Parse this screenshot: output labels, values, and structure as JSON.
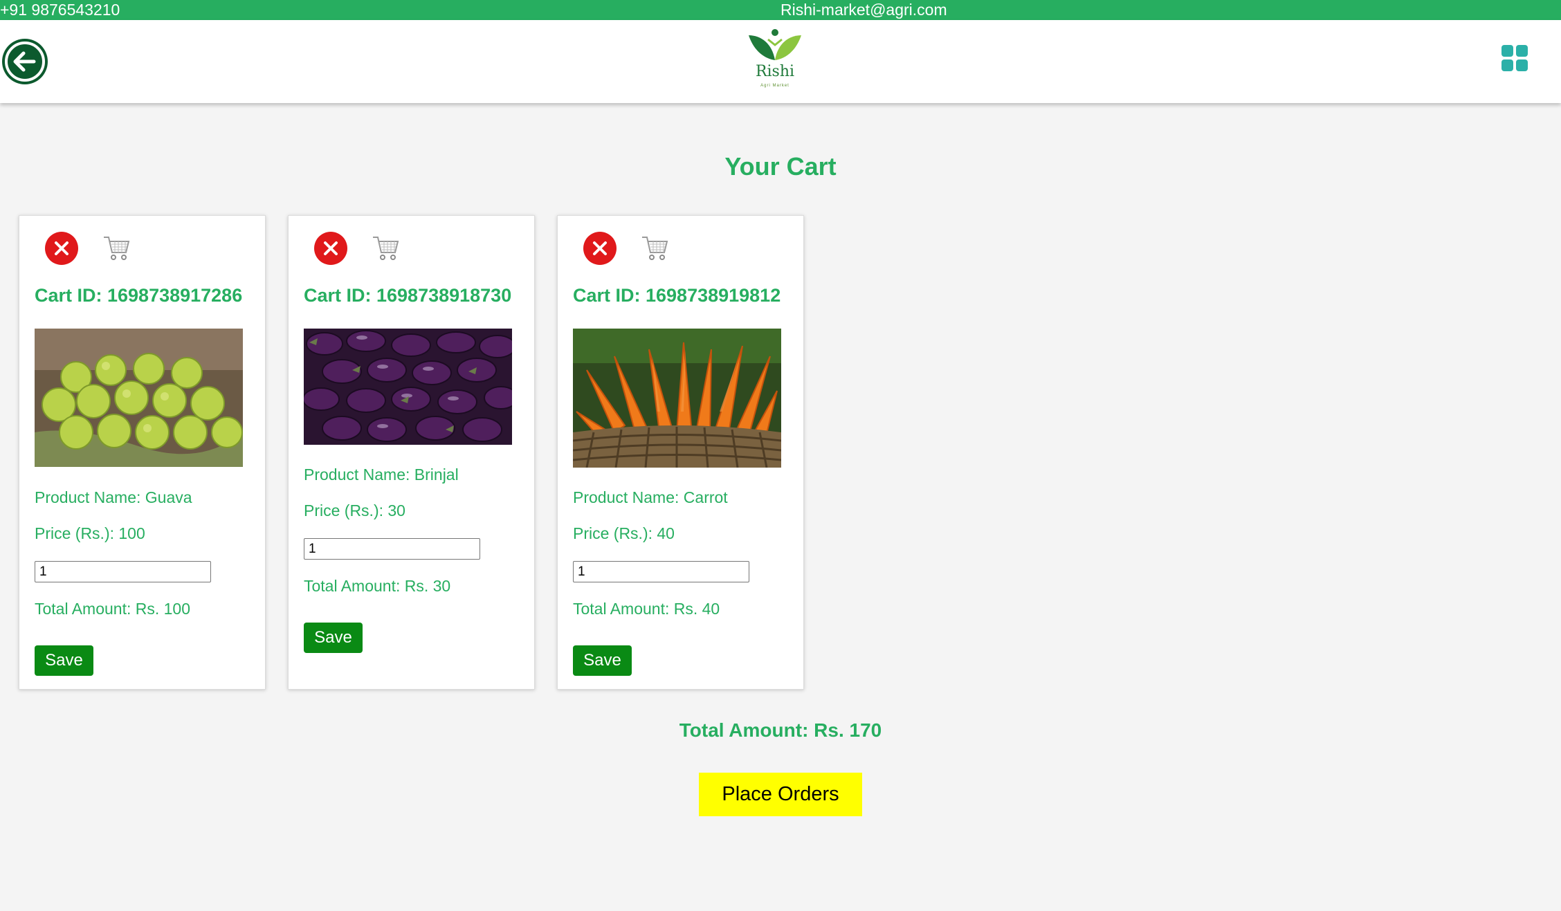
{
  "topbar": {
    "phone": "+91 9876543210",
    "email": "Rishi-market@agri.com"
  },
  "header": {
    "back_icon": "arrow-left-circle-icon",
    "logo_name": "Rishi",
    "logo_tagline": "Agri Market",
    "menu_icon": "grid-menu-icon"
  },
  "colors": {
    "accent": "#27ae60",
    "save": "#0a8a14",
    "remove": "#e0191b",
    "place_order": "#ffff00"
  },
  "page_title": "Your Cart",
  "cart_items": [
    {
      "cart_id": "Cart ID: 1698738917286",
      "product_name": "Product Name: Guava",
      "price": "Price (Rs.): 100",
      "quantity": "1",
      "total": "Total Amount: Rs. 100",
      "save_label": "Save",
      "image_icon": "guava-photo"
    },
    {
      "cart_id": "Cart ID: 1698738918730",
      "product_name": "Product Name: Brinjal",
      "price": "Price (Rs.): 30",
      "quantity": "1",
      "total": "Total Amount: Rs. 30",
      "save_label": "Save",
      "image_icon": "brinjal-photo"
    },
    {
      "cart_id": "Cart ID: 1698738919812",
      "product_name": "Product Name: Carrot",
      "price": "Price (Rs.): 40",
      "quantity": "1",
      "total": "Total Amount: Rs. 40",
      "save_label": "Save",
      "image_icon": "carrot-photo"
    }
  ],
  "grand_total": "Total Amount: Rs. 170",
  "place_orders_label": "Place Orders"
}
